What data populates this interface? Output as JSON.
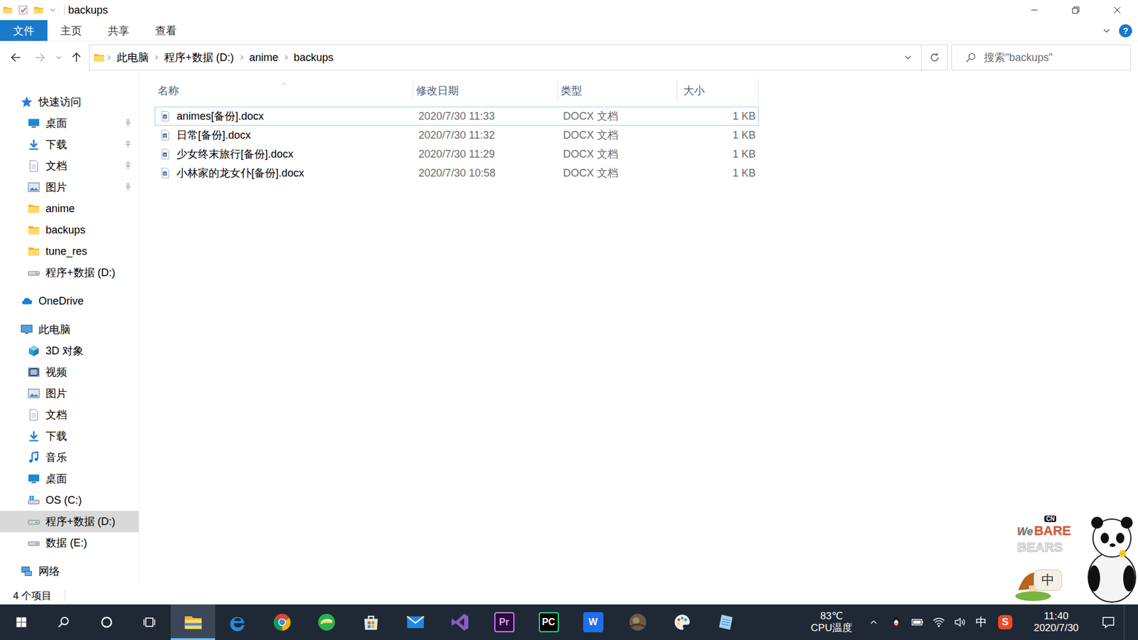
{
  "window": {
    "title": "backups"
  },
  "ribbon": {
    "tabs": [
      {
        "label": "文件",
        "selected": true
      },
      {
        "label": "主页",
        "selected": false
      },
      {
        "label": "共享",
        "selected": false
      },
      {
        "label": "查看",
        "selected": false
      }
    ],
    "help": "?"
  },
  "address": {
    "path": [
      "此电脑",
      "程序+数据 (D:)",
      "anime",
      "backups"
    ]
  },
  "search": {
    "placeholder": "搜索\"backups\""
  },
  "sidebar": {
    "items": [
      {
        "label": "快速访问",
        "kind": "star",
        "level": 0,
        "pinned": false,
        "selected": false
      },
      {
        "label": "桌面",
        "kind": "desktop",
        "level": 1,
        "pinned": true,
        "selected": false
      },
      {
        "label": "下载",
        "kind": "download",
        "level": 1,
        "pinned": true,
        "selected": false
      },
      {
        "label": "文档",
        "kind": "document",
        "level": 1,
        "pinned": true,
        "selected": false
      },
      {
        "label": "图片",
        "kind": "picture",
        "level": 1,
        "pinned": true,
        "selected": false
      },
      {
        "label": "anime",
        "kind": "folder",
        "level": 1,
        "pinned": false,
        "selected": false
      },
      {
        "label": "backups",
        "kind": "folder",
        "level": 1,
        "pinned": false,
        "selected": false
      },
      {
        "label": "tune_res",
        "kind": "folder",
        "level": 1,
        "pinned": false,
        "selected": false
      },
      {
        "label": "程序+数据 (D:)",
        "kind": "drive",
        "level": 1,
        "pinned": false,
        "selected": false
      },
      {
        "label": "OneDrive",
        "kind": "cloud",
        "level": 0,
        "pinned": false,
        "selected": false
      },
      {
        "label": "此电脑",
        "kind": "computer",
        "level": 0,
        "pinned": false,
        "selected": false
      },
      {
        "label": "3D 对象",
        "kind": "cube",
        "level": 1,
        "pinned": false,
        "selected": false
      },
      {
        "label": "视频",
        "kind": "video",
        "level": 1,
        "pinned": false,
        "selected": false
      },
      {
        "label": "图片",
        "kind": "picture",
        "level": 1,
        "pinned": false,
        "selected": false
      },
      {
        "label": "文档",
        "kind": "document",
        "level": 1,
        "pinned": false,
        "selected": false
      },
      {
        "label": "下载",
        "kind": "download",
        "level": 1,
        "pinned": false,
        "selected": false
      },
      {
        "label": "音乐",
        "kind": "music",
        "level": 1,
        "pinned": false,
        "selected": false
      },
      {
        "label": "桌面",
        "kind": "desktop",
        "level": 1,
        "pinned": false,
        "selected": false
      },
      {
        "label": "OS (C:)",
        "kind": "osdrive",
        "level": 1,
        "pinned": false,
        "selected": false
      },
      {
        "label": "程序+数据 (D:)",
        "kind": "drive",
        "level": 1,
        "pinned": false,
        "selected": true
      },
      {
        "label": "数据 (E:)",
        "kind": "drive",
        "level": 1,
        "pinned": false,
        "selected": false
      },
      {
        "label": "网络",
        "kind": "network",
        "level": 0,
        "pinned": false,
        "selected": false
      }
    ]
  },
  "table": {
    "columns": [
      {
        "label": "名称",
        "sorted": true
      },
      {
        "label": "修改日期",
        "sorted": false
      },
      {
        "label": "类型",
        "sorted": false
      },
      {
        "label": "大小",
        "sorted": false
      }
    ],
    "rows": [
      {
        "name": "animes[备份].docx",
        "modified": "2020/7/30 11:33",
        "type": "DOCX 文档",
        "size": "1 KB",
        "selected": false,
        "focused": true
      },
      {
        "name": "日常[备份].docx",
        "modified": "2020/7/30 11:32",
        "type": "DOCX 文档",
        "size": "1 KB",
        "selected": false,
        "focused": false
      },
      {
        "name": "少女终末旅行[备份].docx",
        "modified": "2020/7/30 11:29",
        "type": "DOCX 文档",
        "size": "1 KB",
        "selected": false,
        "focused": false
      },
      {
        "name": "小林家的龙女仆[备份].docx",
        "modified": "2020/7/30 10:58",
        "type": "DOCX 文档",
        "size": "1 KB",
        "selected": false,
        "focused": false
      }
    ]
  },
  "status_bar": {
    "count": "4 个项目"
  },
  "taskbar": {
    "apps": [
      {
        "kind": "explorer",
        "label": "",
        "active": true
      },
      {
        "kind": "edge",
        "label": "",
        "active": false
      },
      {
        "kind": "chrome",
        "label": "",
        "active": false
      },
      {
        "kind": "browser360",
        "label": "",
        "active": false
      },
      {
        "kind": "store",
        "label": "",
        "active": false
      },
      {
        "kind": "mail",
        "label": "",
        "active": false
      },
      {
        "kind": "visualstudio",
        "label": "",
        "active": false
      },
      {
        "kind": "premiere",
        "label": "Pr",
        "active": false
      },
      {
        "kind": "pycharm",
        "label": "PC",
        "active": false
      },
      {
        "kind": "wps",
        "label": "W",
        "active": false
      },
      {
        "kind": "game",
        "label": "",
        "active": false
      },
      {
        "kind": "paint",
        "label": "",
        "active": false
      },
      {
        "kind": "notepad",
        "label": "",
        "active": false
      }
    ],
    "cpu": {
      "temp": "83℃",
      "label": "CPU温度"
    },
    "ime": "中",
    "sogou": "S",
    "time": "11:40",
    "date": "2020/7/30"
  },
  "ime_skin": {
    "badge": "CN",
    "logo": [
      "We",
      "BARE",
      "BEARS"
    ],
    "mode": "中"
  }
}
